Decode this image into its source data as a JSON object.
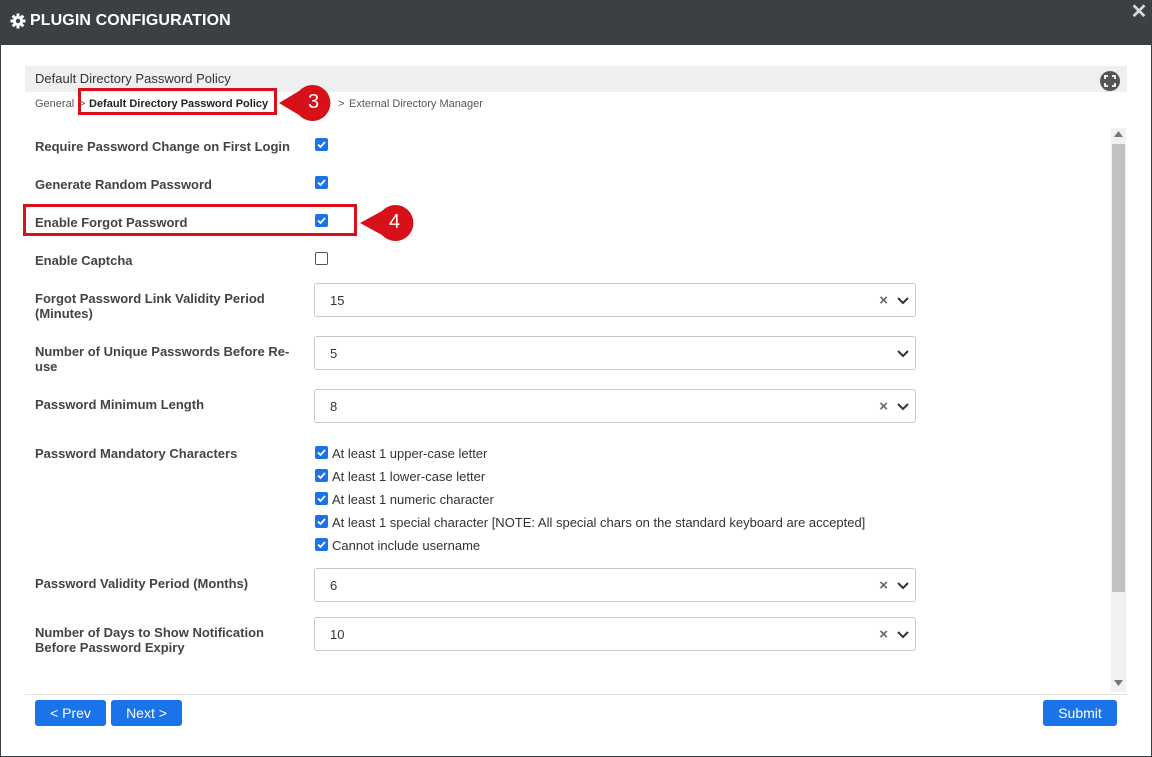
{
  "dialog": {
    "title": "PLUGIN CONFIGURATION",
    "close_glyph": "✕"
  },
  "section": {
    "title": "Default Directory Password Policy"
  },
  "breadcrumb": {
    "items": [
      "General",
      "Default Directory Password Policy",
      "External Directory Manager"
    ],
    "separator": ">"
  },
  "callouts": [
    {
      "number": "3"
    },
    {
      "number": "4"
    }
  ],
  "fields": {
    "require_change": {
      "label": "Require Password Change on First Login",
      "checked": true
    },
    "random_password": {
      "label": "Generate Random Password",
      "checked": true
    },
    "forgot_password": {
      "label": "Enable Forgot Password",
      "checked": true
    },
    "captcha": {
      "label": "Enable Captcha",
      "checked": false
    },
    "link_validity": {
      "label_line1": "Forgot Password Link Validity Period",
      "label_line2": "(Minutes)",
      "value": "15"
    },
    "unique_passwords": {
      "label_line1": "Number of Unique Passwords Before Re-",
      "label_line2": "use",
      "value": "5"
    },
    "min_length": {
      "label": "Password Minimum Length",
      "value": "8"
    },
    "mandatory_chars": {
      "label": "Password Mandatory Characters",
      "options": [
        {
          "label": "At least 1 upper-case letter",
          "checked": true
        },
        {
          "label": "At least 1 lower-case letter",
          "checked": true
        },
        {
          "label": "At least 1 numeric character",
          "checked": true
        },
        {
          "label": "At least 1 special character [NOTE: All special chars on the standard keyboard are accepted]",
          "checked": true
        },
        {
          "label": "Cannot include username",
          "checked": true
        }
      ]
    },
    "validity_months": {
      "label": "Password Validity Period (Months)",
      "value": "6"
    },
    "notify_days": {
      "label_line1": "Number of Days to Show Notification",
      "label_line2": "Before Password Expiry",
      "value": "10"
    }
  },
  "buttons": {
    "prev": "< Prev",
    "next": "Next >",
    "submit": "Submit"
  },
  "colors": {
    "accent": "#1a73e8",
    "titlebar": "#3b4045",
    "highlight": "#d8101a"
  },
  "icons": {
    "title": "gear-icon",
    "close": "close-icon",
    "expand": "expand-icon",
    "select_caret": "chevron-down-icon",
    "select_clear": "clear-icon"
  }
}
